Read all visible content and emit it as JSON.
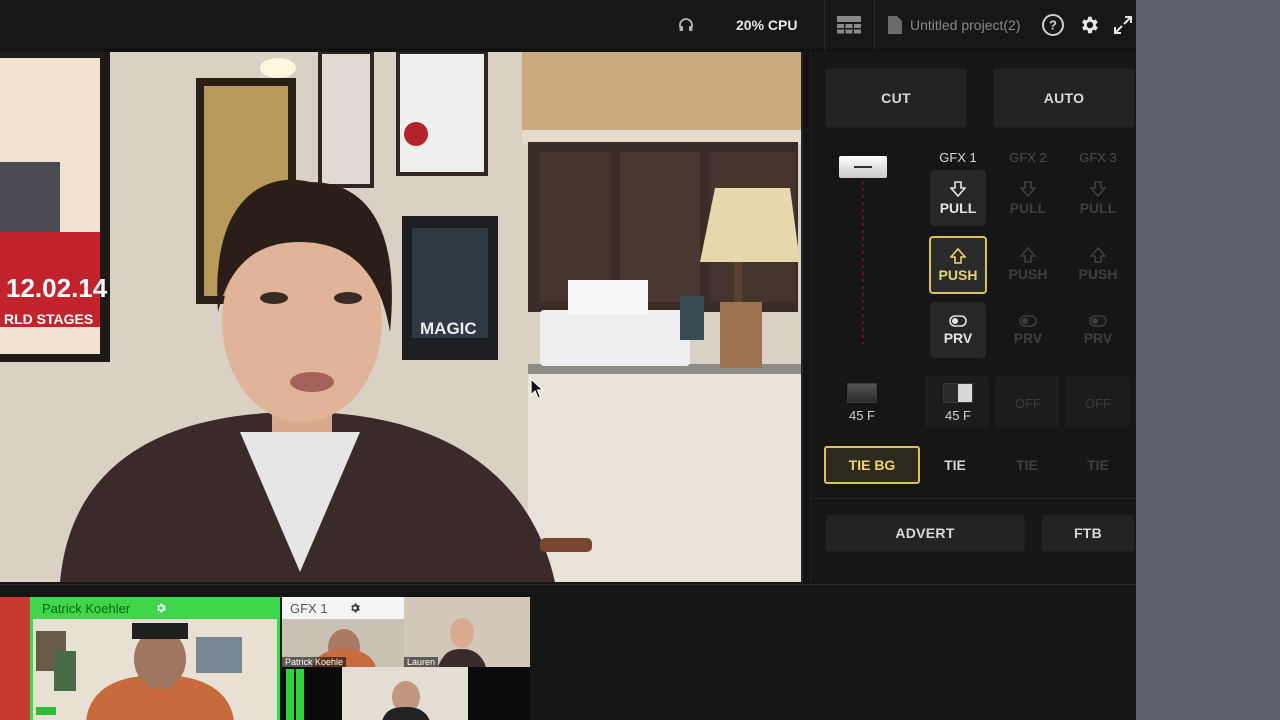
{
  "topbar": {
    "headphones_icon": "headphones-icon",
    "cpu_label": "20% CPU",
    "layout_icon": "multiview-layout-icon",
    "project_name": "Untitled project(2)",
    "help_icon": "help-icon",
    "settings_icon": "gear-icon",
    "fullscreen_icon": "fullscreen-icon"
  },
  "program": {
    "poster_date": "12.02.14",
    "poster_text": "RLD STAGES",
    "frame_text": "MAGIC"
  },
  "controls": {
    "cut_label": "CUT",
    "auto_label": "AUTO",
    "gfx": [
      {
        "name": "GFX 1",
        "pull": "PULL",
        "push": "PUSH",
        "prv": "PRV",
        "transition": "45 F",
        "tie": "TIE",
        "enabled": true
      },
      {
        "name": "GFX 2",
        "pull": "PULL",
        "push": "PUSH",
        "prv": "PRV",
        "transition": "OFF",
        "tie": "TIE",
        "enabled": false
      },
      {
        "name": "GFX 3",
        "pull": "PULL",
        "push": "PUSH",
        "prv": "PRV",
        "transition": "OFF",
        "tie": "TIE",
        "enabled": false
      }
    ],
    "bg_transition": "45 F",
    "tie_bg_label": "TIE BG",
    "advert_label": "ADVERT",
    "ftb_label": "FTB",
    "accent_color": "#d7c45e"
  },
  "multiview": {
    "source1_label": "Patrick Koehler",
    "source2_label": "GFX 1",
    "tile_patrick": "Patrick Koehle",
    "tile_lauren": "Lauren",
    "tally_color": "#30e342"
  }
}
